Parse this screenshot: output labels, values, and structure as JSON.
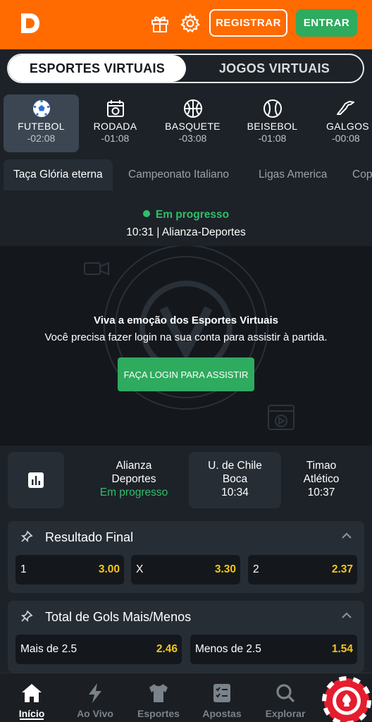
{
  "header": {
    "register_label": "REGISTRAR",
    "login_label": "ENTRAR",
    "colors": {
      "bar": "#ff6b00",
      "login": "#2eab5e"
    }
  },
  "segment": {
    "active": "ESPORTES VIRTUAIS",
    "inactive": "JOGOS VIRTUAIS"
  },
  "sports": [
    {
      "label": "FUTEBOL",
      "time": "-02:08",
      "icon": "soccer-ball-icon"
    },
    {
      "label": "RODADA",
      "time": "-01:08",
      "icon": "calendar-ball-icon"
    },
    {
      "label": "BASQUETE",
      "time": "-03:08",
      "icon": "basketball-icon"
    },
    {
      "label": "BEISEBOL",
      "time": "-01:08",
      "icon": "baseball-icon"
    },
    {
      "label": "GALGOS",
      "time": "-00:08",
      "icon": "greyhound-icon"
    }
  ],
  "leagues": [
    "Taça Glória eterna",
    "Campeonato Italiano",
    "Ligas America",
    "Cop"
  ],
  "status": {
    "label": "Em progresso",
    "match": "10:31 | Alianza-Deportes"
  },
  "video": {
    "title": "Viva a emoção dos Esportes Virtuais",
    "subtitle": "Você precisa fazer login na sua conta para assistir à partida.",
    "button": "FAÇA LOGIN PARA ASSISTIR"
  },
  "matches": [
    {
      "line1": "Alianza",
      "line2": "Deportes",
      "line3": "Em progresso"
    },
    {
      "line1": "U. de Chile",
      "line2": "Boca",
      "line3": "10:34"
    },
    {
      "line1": "Timao",
      "line2": "Atlético",
      "line3": "10:37"
    }
  ],
  "markets": [
    {
      "title": "Resultado Final",
      "odds": [
        {
          "label": "1",
          "value": "3.00"
        },
        {
          "label": "X",
          "value": "3.30"
        },
        {
          "label": "2",
          "value": "2.37"
        }
      ]
    },
    {
      "title": "Total de Gols Mais/Menos",
      "odds": [
        {
          "label": "Mais de 2.5",
          "value": "2.46"
        },
        {
          "label": "Menos de 2.5",
          "value": "1.54"
        }
      ]
    }
  ],
  "nav": [
    {
      "label": "Início",
      "icon": "home-icon"
    },
    {
      "label": "Ao Vivo",
      "icon": "lightning-icon"
    },
    {
      "label": "Esportes",
      "icon": "jersey-icon"
    },
    {
      "label": "Apostas",
      "icon": "betslip-icon"
    },
    {
      "label": "Explorar",
      "icon": "search-icon"
    }
  ]
}
